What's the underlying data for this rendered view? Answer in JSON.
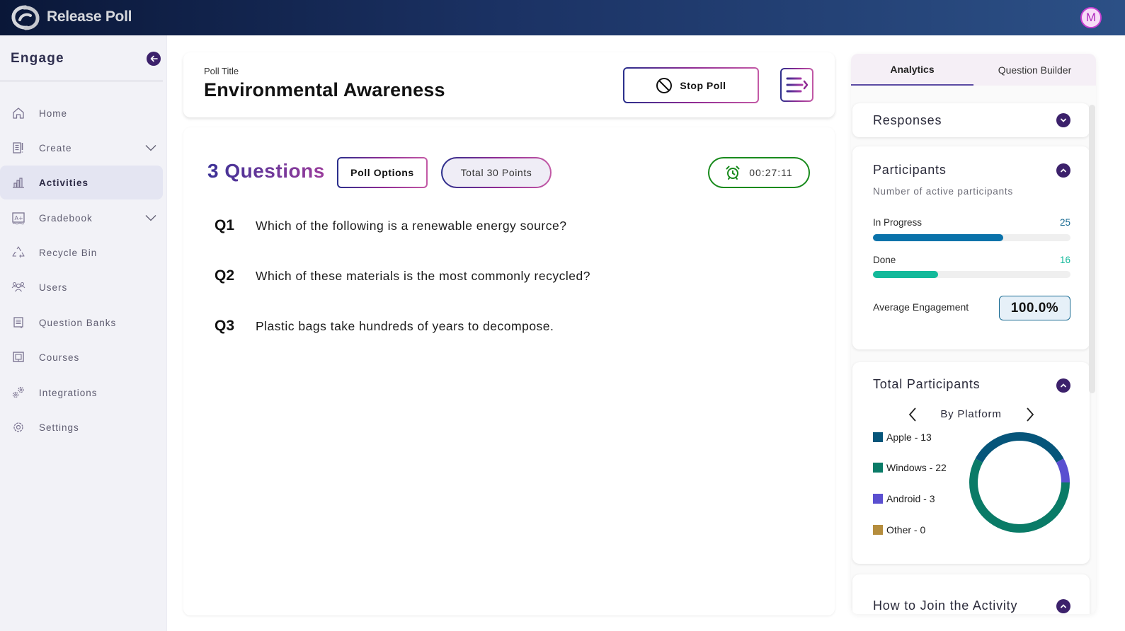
{
  "app": {
    "brand": "Release Poll",
    "user_initial": "M",
    "accent_color": "#3c216b"
  },
  "sidebar": {
    "section_title": "Engage",
    "collapse_icon": "arrow-left-icon",
    "items": [
      {
        "label": "Home",
        "icon": "home-icon",
        "expandable": false,
        "active": false
      },
      {
        "label": "Create",
        "icon": "create-icon",
        "expandable": true,
        "active": false
      },
      {
        "label": "Activities",
        "icon": "bar-chart-icon",
        "expandable": false,
        "active": true
      },
      {
        "label": "Gradebook",
        "icon": "gradebook-icon",
        "expandable": true,
        "active": false
      },
      {
        "label": "Recycle Bin",
        "icon": "recycle-icon",
        "expandable": false,
        "active": false
      },
      {
        "label": "Users",
        "icon": "users-icon",
        "expandable": false,
        "active": false
      },
      {
        "label": "Question Banks",
        "icon": "question-bank-icon",
        "expandable": false,
        "active": false
      },
      {
        "label": "Courses",
        "icon": "courses-icon",
        "expandable": false,
        "active": false
      },
      {
        "label": "Integrations",
        "icon": "integrations-icon",
        "expandable": false,
        "active": false
      },
      {
        "label": "Settings",
        "icon": "settings-icon",
        "expandable": false,
        "active": false
      }
    ]
  },
  "header": {
    "poll_label": "Poll Title",
    "poll_title": "Environmental Awareness",
    "stop_button": "Stop Poll",
    "menu_icon": "collapse-menu-icon"
  },
  "content": {
    "question_count": "3 Questions",
    "poll_options_button": "Poll Options",
    "total_points": "Total 30 Points",
    "timer": "00:27:11",
    "timer_color": "#188a1c",
    "questions": [
      {
        "num": "Q1",
        "text": "Which of the following is a renewable energy source?"
      },
      {
        "num": "Q2",
        "text": "Which of these materials is the most commonly recycled?"
      },
      {
        "num": "Q3",
        "text": "Plastic bags take hundreds of years to decompose."
      }
    ]
  },
  "right_panel": {
    "tabs": [
      {
        "label": "Analytics",
        "active": true
      },
      {
        "label": "Question Builder",
        "active": false
      }
    ],
    "responses": {
      "title": "Responses",
      "expanded": false
    },
    "participants": {
      "title": "Participants",
      "subtitle": "Number of active participants",
      "expanded": true,
      "bars": [
        {
          "label": "In Progress",
          "value": "25",
          "fill_fraction": 0.66,
          "color": "#0a72aa"
        },
        {
          "label": "Done",
          "value": "16",
          "fill_fraction": 0.33,
          "color": "#12b99a"
        }
      ],
      "avg_engagement_label": "Average Engagement",
      "avg_engagement_value": "100.0%"
    },
    "total_participants": {
      "title": "Total Participants",
      "expanded": true,
      "view_label": "By Platform"
    },
    "how_to_join": {
      "title": "How to Join the Activity",
      "expanded": true
    }
  },
  "chart_data": {
    "type": "pie",
    "title": "Total Participants",
    "subtitle": "By Platform",
    "donut": true,
    "categories": [
      "Apple",
      "Windows",
      "Android",
      "Other"
    ],
    "values": [
      13,
      22,
      3,
      0
    ],
    "legend_labels": [
      "Apple - 13",
      "Windows - 22",
      "Android - 3",
      "Other - 0"
    ],
    "colors": [
      "#06557a",
      "#0a7b67",
      "#5a4fd0",
      "#b58d3d"
    ],
    "draw_order": [
      "Windows",
      "Apple",
      "Android",
      "Other"
    ],
    "start_angle_deg": 90,
    "direction": "clockwise",
    "legend_position": "left"
  }
}
